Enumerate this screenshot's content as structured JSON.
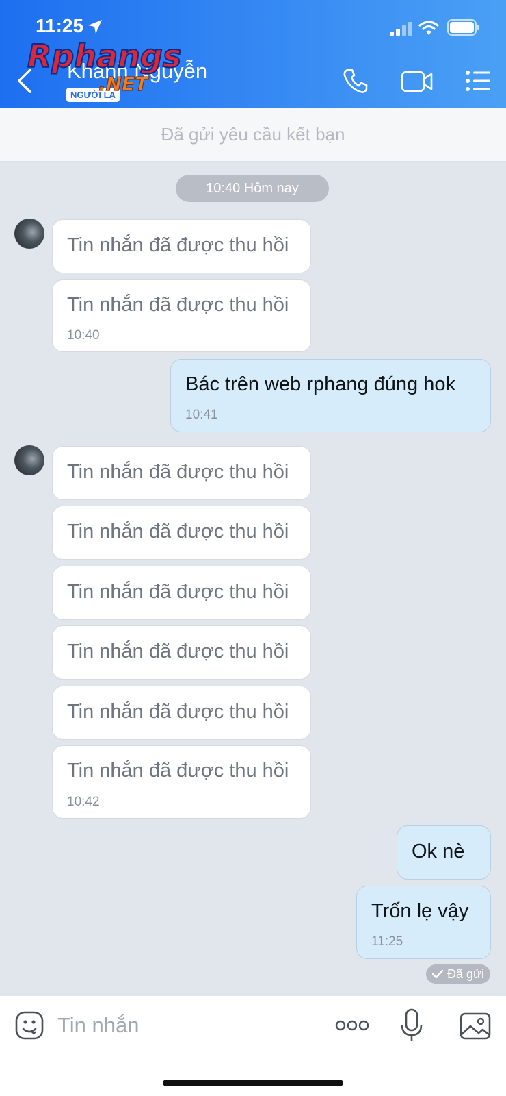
{
  "status": {
    "time": "11:25"
  },
  "header": {
    "contact_name": "Khanh Nguyễn",
    "badge": "NGƯỜI LẠ",
    "logo_text": "Rphangs",
    "logo_suffix": ".NET"
  },
  "friend_request": {
    "text": "Đã gửi yêu cầu kết bạn"
  },
  "date_pill": "10:40 Hôm nay",
  "messages": [
    {
      "side": "in",
      "text": "Tin nhắn đã được thu hồi"
    },
    {
      "side": "in",
      "text": "Tin nhắn đã được thu hồi",
      "time": "10:40"
    },
    {
      "side": "out",
      "text": "Bác trên web rphang đúng hok",
      "time": "10:41"
    },
    {
      "side": "in",
      "text": "Tin nhắn đã được thu hồi"
    },
    {
      "side": "in",
      "text": "Tin nhắn đã được thu hồi"
    },
    {
      "side": "in",
      "text": "Tin nhắn đã được thu hồi"
    },
    {
      "side": "in",
      "text": "Tin nhắn đã được thu hồi"
    },
    {
      "side": "in",
      "text": "Tin nhắn đã được thu hồi"
    },
    {
      "side": "in",
      "text": "Tin nhắn đã được thu hồi",
      "time": "10:42"
    },
    {
      "side": "out",
      "text": "Ok nè"
    },
    {
      "side": "out",
      "text": "Trốn lẹ vậy",
      "time": "11:25"
    }
  ],
  "sent_status": "Đã gửi",
  "input": {
    "placeholder": "Tin nhắn"
  },
  "colors": {
    "header_start": "#1e6ff0",
    "header_end": "#4aa0f5",
    "outgoing_bubble": "#d6ecfb",
    "chat_bg": "#e1e5ec"
  }
}
